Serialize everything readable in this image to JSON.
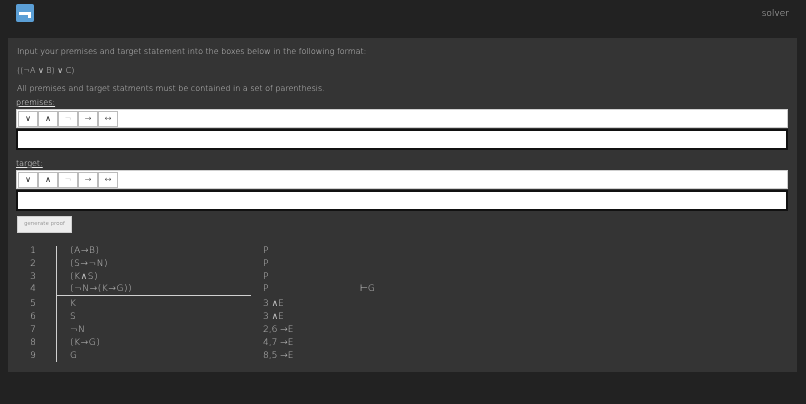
{
  "header": {
    "logo_icon": "sheet-logo-icon",
    "title": "solver"
  },
  "instructions": {
    "line1": "Input your premises and target statement into the boxes below in the following format:",
    "example": "((¬A ∨ B) ∨ C)",
    "line2": "All premises and target statments must be contained in a set of parenthesis."
  },
  "premises": {
    "label": "premises:",
    "symbols": [
      "∨",
      "∧",
      "¬",
      "→",
      "↔"
    ],
    "value": ""
  },
  "target": {
    "label": "target:",
    "symbols": [
      "∨",
      "∧",
      "¬",
      "→",
      "↔"
    ],
    "value": ""
  },
  "generate_button": "generate proof",
  "proof": {
    "goal": "⊢G",
    "lines": [
      {
        "num": "1",
        "formula": "(A→B)",
        "just": "P"
      },
      {
        "num": "2",
        "formula": "(S→¬N)",
        "just": "P"
      },
      {
        "num": "3",
        "formula": "(K∧S)",
        "just": "P"
      },
      {
        "num": "4",
        "formula": "(¬N→(K→G))",
        "just": "P"
      },
      {
        "num": "5",
        "formula": "K",
        "just": "3 ∧E"
      },
      {
        "num": "6",
        "formula": "S",
        "just": "3 ∧E"
      },
      {
        "num": "7",
        "formula": "¬N",
        "just": "2,6 →E"
      },
      {
        "num": "8",
        "formula": "(K→G)",
        "just": "4,7 →E"
      },
      {
        "num": "9",
        "formula": "G",
        "just": "8,5 →E"
      }
    ]
  }
}
